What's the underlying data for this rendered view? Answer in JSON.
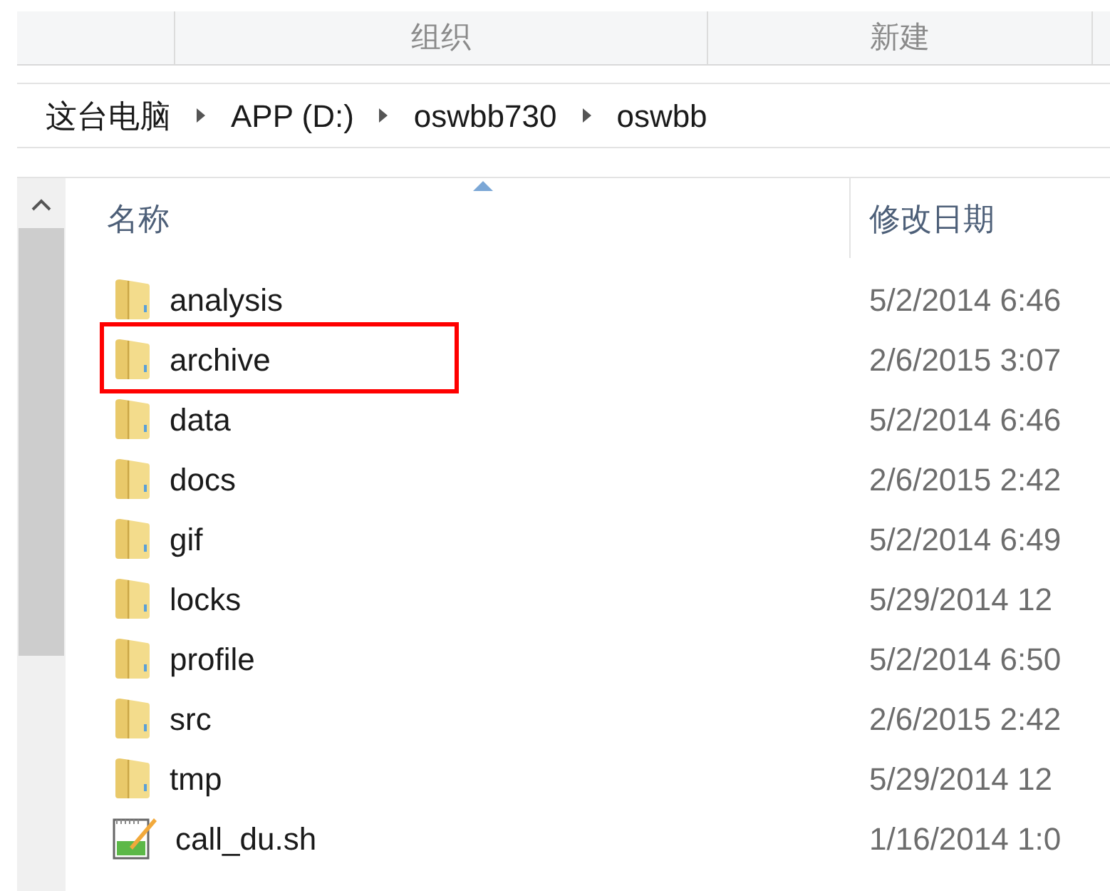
{
  "toolbar": {
    "buttons": [
      "组织",
      "新建"
    ]
  },
  "breadcrumb": [
    "这台电脑",
    "APP (D:)",
    "oswbb730",
    "oswbb"
  ],
  "columns": [
    {
      "label": "名称",
      "sorted": true
    },
    {
      "label": "修改日期",
      "sorted": false
    }
  ],
  "rows": [
    {
      "kind": "folder",
      "name": "analysis",
      "date": "5/2/2014 6:46",
      "highlighted": false
    },
    {
      "kind": "folder",
      "name": "archive",
      "date": "2/6/2015 3:07",
      "highlighted": true
    },
    {
      "kind": "folder",
      "name": "data",
      "date": "5/2/2014 6:46",
      "highlighted": false
    },
    {
      "kind": "folder",
      "name": "docs",
      "date": "2/6/2015 2:42",
      "highlighted": false
    },
    {
      "kind": "folder",
      "name": "gif",
      "date": "5/2/2014 6:49",
      "highlighted": false
    },
    {
      "kind": "folder",
      "name": "locks",
      "date": "5/29/2014 12",
      "highlighted": false
    },
    {
      "kind": "folder",
      "name": "profile",
      "date": "5/2/2014 6:50",
      "highlighted": false
    },
    {
      "kind": "folder",
      "name": "src",
      "date": "2/6/2015 2:42",
      "highlighted": false
    },
    {
      "kind": "folder",
      "name": "tmp",
      "date": "5/29/2014 12",
      "highlighted": false
    },
    {
      "kind": "script",
      "name": "call_du.sh",
      "date": "1/16/2014 1:0",
      "highlighted": false
    }
  ]
}
